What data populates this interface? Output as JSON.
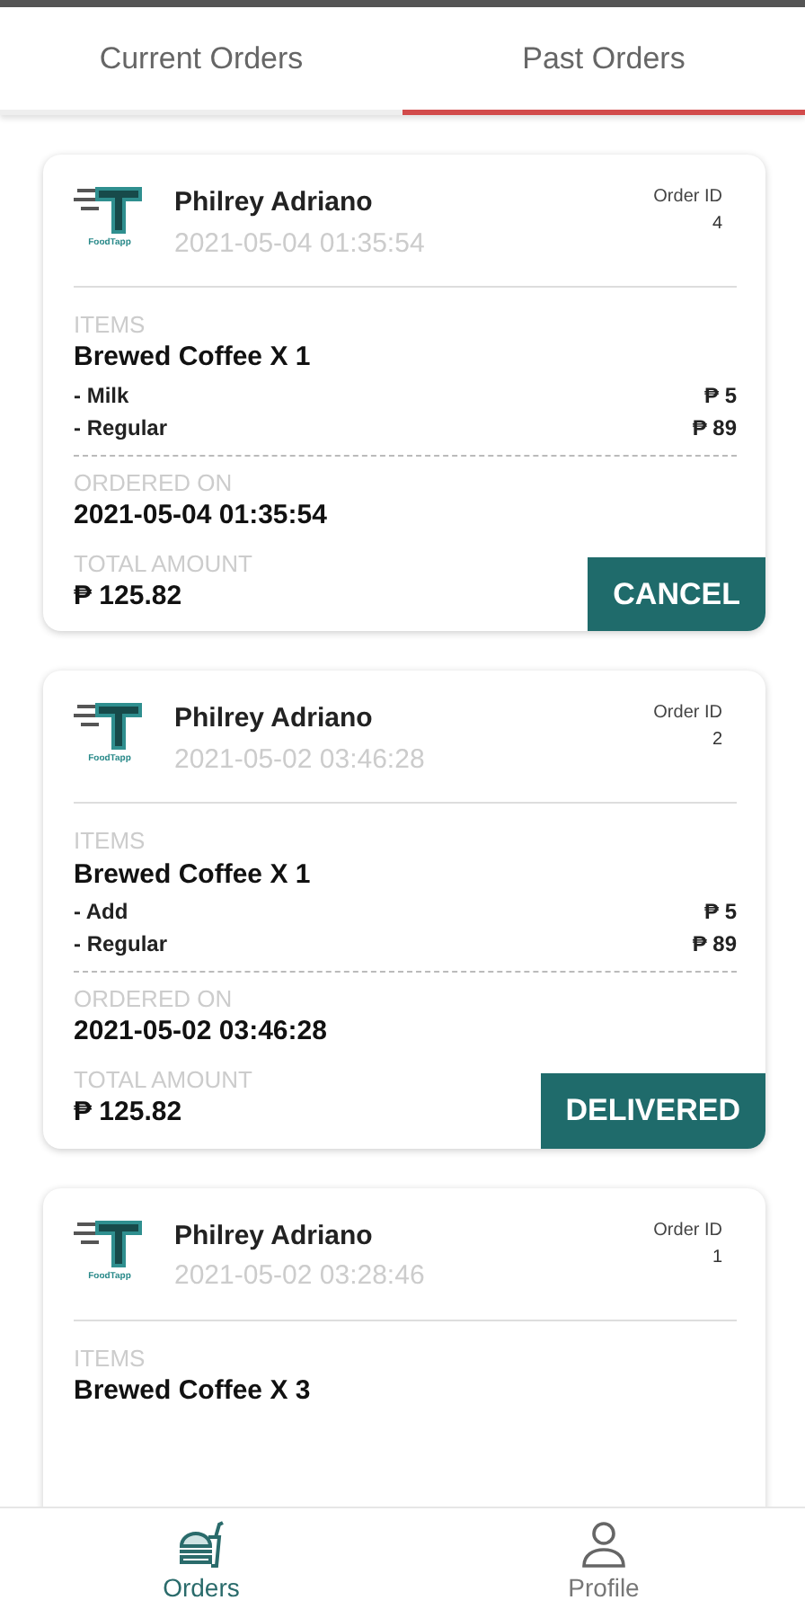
{
  "tabs": [
    {
      "label": "Current Orders",
      "selected": false
    },
    {
      "label": "Past Orders",
      "selected": true
    }
  ],
  "orders": [
    {
      "logo_text": "FoodTapp",
      "customer": "Philrey Adriano",
      "timestamp": "2021-05-04 01:35:54",
      "order_id_label": "Order ID",
      "order_id": "4",
      "items_label": "ITEMS",
      "items": [
        {
          "name": "Brewed Coffee X 1",
          "options": [
            {
              "label": "- Milk",
              "price": "₱ 5"
            },
            {
              "label": "- Regular",
              "price": "₱ 89"
            }
          ]
        }
      ],
      "ordered_on_label": "ORDERED ON",
      "ordered_on": "2021-05-04 01:35:54",
      "total_label": "TOTAL AMOUNT",
      "total": "₱ 125.82",
      "action": "CANCEL"
    },
    {
      "logo_text": "FoodTapp",
      "customer": "Philrey Adriano",
      "timestamp": "2021-05-02 03:46:28",
      "order_id_label": "Order ID",
      "order_id": "2",
      "items_label": "ITEMS",
      "items": [
        {
          "name": "Brewed Coffee X 1",
          "options": [
            {
              "label": "- Add",
              "price": "₱ 5"
            },
            {
              "label": "- Regular",
              "price": "₱ 89"
            }
          ]
        }
      ],
      "ordered_on_label": "ORDERED ON",
      "ordered_on": "2021-05-02 03:46:28",
      "total_label": "TOTAL AMOUNT",
      "total": "₱ 125.82",
      "action": "DELIVERED"
    },
    {
      "logo_text": "FoodTapp",
      "customer": "Philrey Adriano",
      "timestamp": "2021-05-02 03:28:46",
      "order_id_label": "Order ID",
      "order_id": "1",
      "items_label": "ITEMS",
      "items": [
        {
          "name": "Brewed Coffee X 3"
        }
      ]
    }
  ],
  "bottom_nav": [
    {
      "label": "Orders",
      "selected": true
    },
    {
      "label": "Profile",
      "selected": false
    }
  ]
}
